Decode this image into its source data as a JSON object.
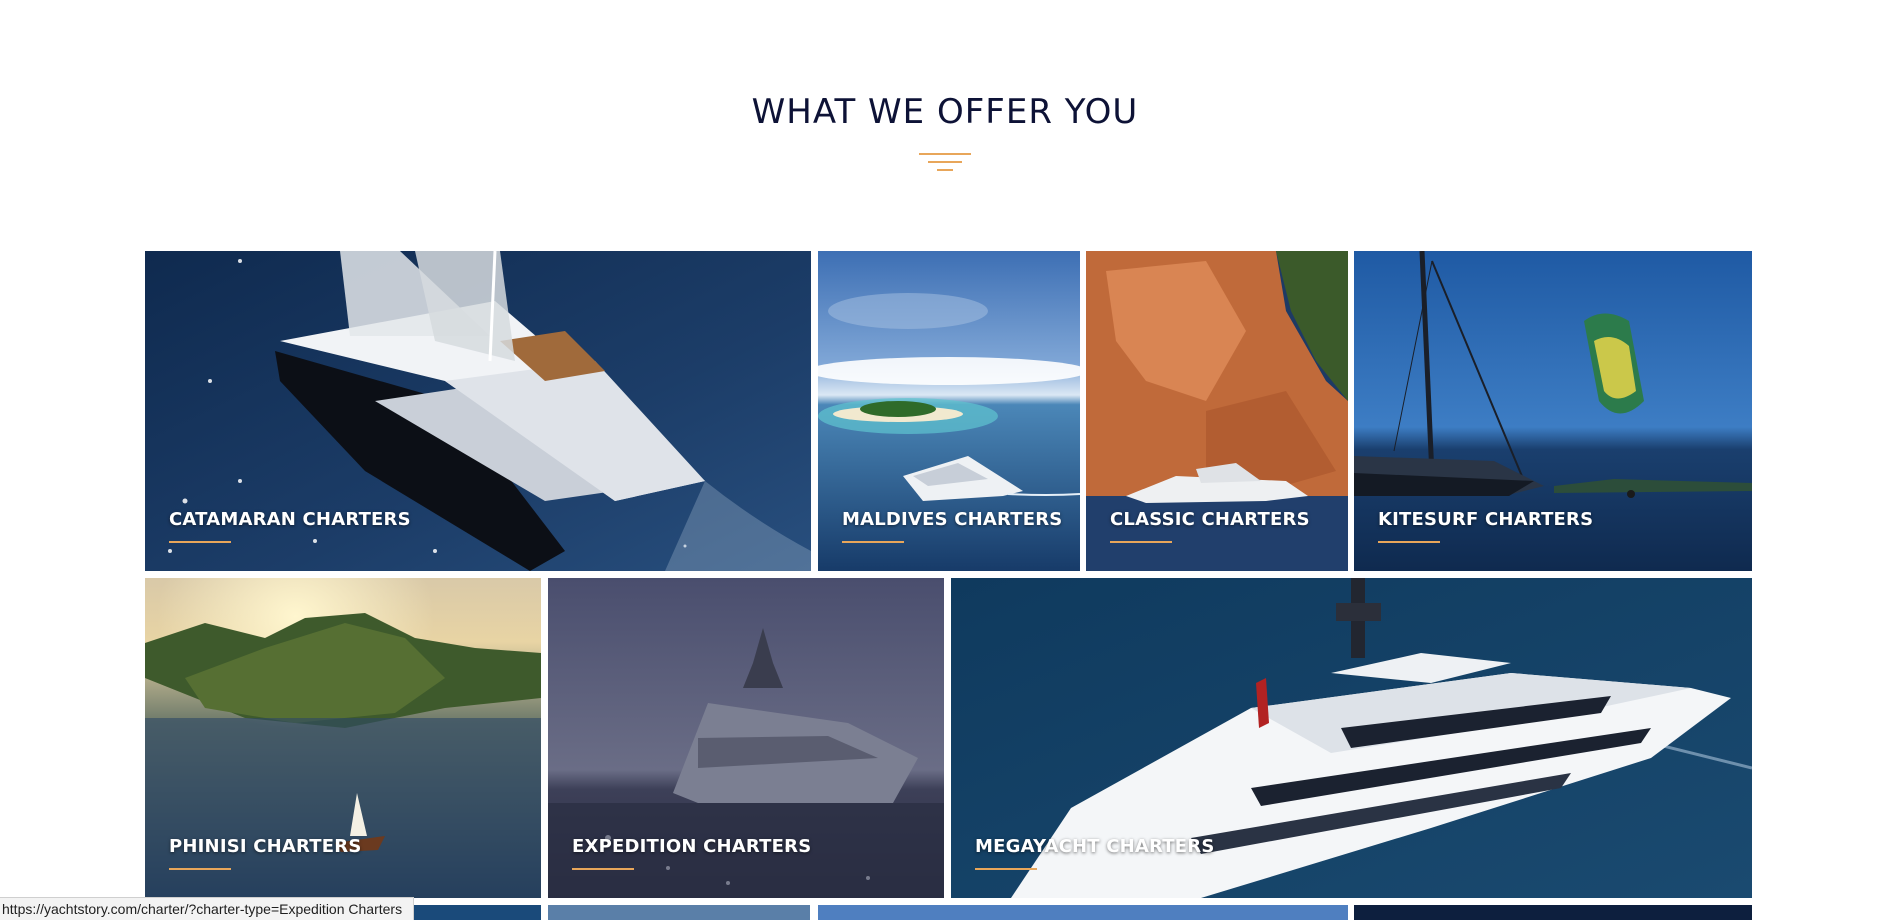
{
  "section": {
    "title": "WHAT WE OFFER YOU"
  },
  "tiles": [
    {
      "label": "CATAMARAN CHARTERS"
    },
    {
      "label": "MALDIVES CHARTERS"
    },
    {
      "label": "CLASSIC CHARTERS"
    },
    {
      "label": "KITESURF CHARTERS"
    },
    {
      "label": "PHINISI CHARTERS"
    },
    {
      "label": "EXPEDITION CHARTERS"
    },
    {
      "label": "MEGAYACHT CHARTERS"
    }
  ],
  "status_bar": {
    "url": "https://yachtstory.com/charter/?charter-type=Expedition Charters"
  },
  "colors": {
    "heading": "#0d1236",
    "accent": "#e8a65a",
    "ocean": "#1b3a63"
  }
}
